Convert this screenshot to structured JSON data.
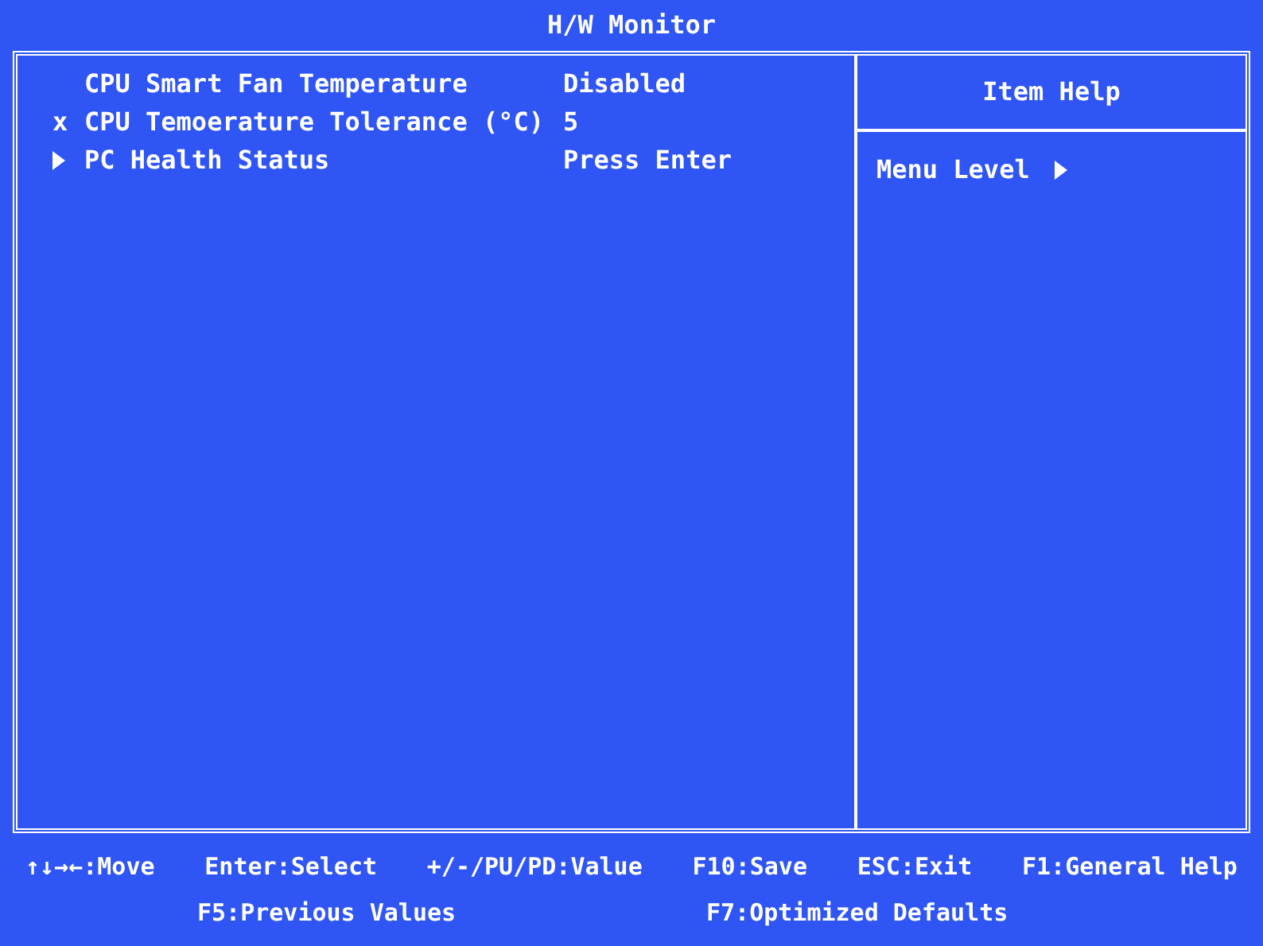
{
  "window": {
    "title": "H/W Monitor"
  },
  "items": [
    {
      "kind": "setting",
      "label": "CPU Smart Fan Temperature",
      "value": "Disabled"
    },
    {
      "kind": "disabled",
      "marker": "x",
      "label": "CPU Temoerature Tolerance (°C)",
      "value": "5"
    },
    {
      "kind": "submenu",
      "label": "PC Health Status",
      "value": "Press Enter"
    }
  ],
  "help": {
    "title": "Item Help",
    "menu_level_label": "Menu Level"
  },
  "footer": {
    "row_1": [
      "↑↓→←:Move",
      "Enter:Select",
      "+/-/PU/PD:Value",
      "F10:Save",
      "ESC:Exit",
      "F1:General Help"
    ],
    "row_2": [
      "F5:Previous Values",
      "F7:Optimized Defaults"
    ]
  }
}
